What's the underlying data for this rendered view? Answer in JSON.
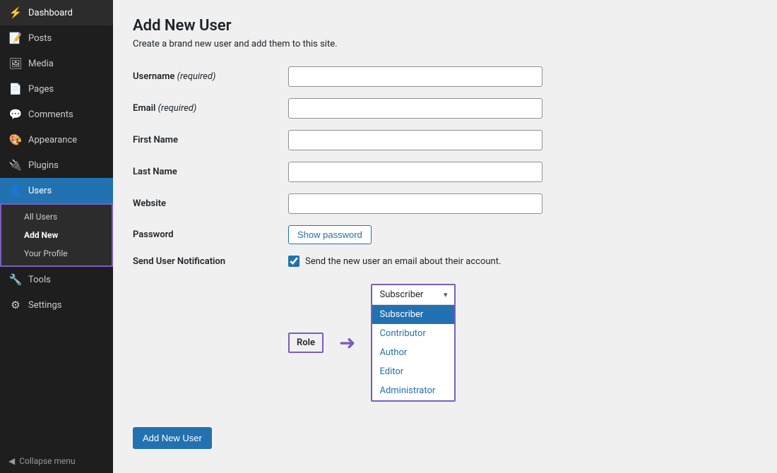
{
  "sidebar": {
    "items": [
      {
        "id": "dashboard",
        "label": "Dashboard",
        "icon": "⚡"
      },
      {
        "id": "posts",
        "label": "Posts",
        "icon": "📝"
      },
      {
        "id": "media",
        "label": "Media",
        "icon": "🖼"
      },
      {
        "id": "pages",
        "label": "Pages",
        "icon": "📄"
      },
      {
        "id": "comments",
        "label": "Comments",
        "icon": "💬"
      },
      {
        "id": "appearance",
        "label": "Appearance",
        "icon": "🎨"
      },
      {
        "id": "plugins",
        "label": "Plugins",
        "icon": "🔌"
      },
      {
        "id": "users",
        "label": "Users",
        "icon": "👤"
      }
    ],
    "submenu": [
      {
        "id": "all-users",
        "label": "All Users"
      },
      {
        "id": "add-new",
        "label": "Add New"
      },
      {
        "id": "your-profile",
        "label": "Your Profile"
      }
    ],
    "bottom_items": [
      {
        "id": "tools",
        "label": "Tools",
        "icon": "🔧"
      },
      {
        "id": "settings",
        "label": "Settings",
        "icon": "⚙"
      }
    ],
    "collapse_label": "Collapse menu"
  },
  "page": {
    "title": "Add New User",
    "subtitle_prefix": "Create a brand new user and add them to this site.",
    "subtitle_link_text": "new user"
  },
  "form": {
    "username_label": "Username",
    "username_required": "(required)",
    "email_label": "Email",
    "email_required": "(required)",
    "firstname_label": "First Name",
    "lastname_label": "Last Name",
    "website_label": "Website",
    "password_label": "Password",
    "show_password_btn": "Show password",
    "notification_label": "Send User Notification",
    "notification_text": "Send the new user an email about their account.",
    "role_label": "Role",
    "role_arrow": "→",
    "role_selected": "Subscriber",
    "role_options": [
      {
        "id": "subscriber",
        "label": "Subscriber",
        "selected": true
      },
      {
        "id": "contributor",
        "label": "Contributor",
        "selected": false
      },
      {
        "id": "author",
        "label": "Author",
        "selected": false
      },
      {
        "id": "editor",
        "label": "Editor",
        "selected": false
      },
      {
        "id": "administrator",
        "label": "Administrator",
        "selected": false
      }
    ],
    "submit_btn": "Add New User"
  },
  "colors": {
    "accent": "#2271b1",
    "sidebar_active": "#2271b1",
    "sidebar_bg": "#1e1e1e",
    "purple": "#7c5cbf",
    "role_selected_bg": "#2271b1"
  }
}
